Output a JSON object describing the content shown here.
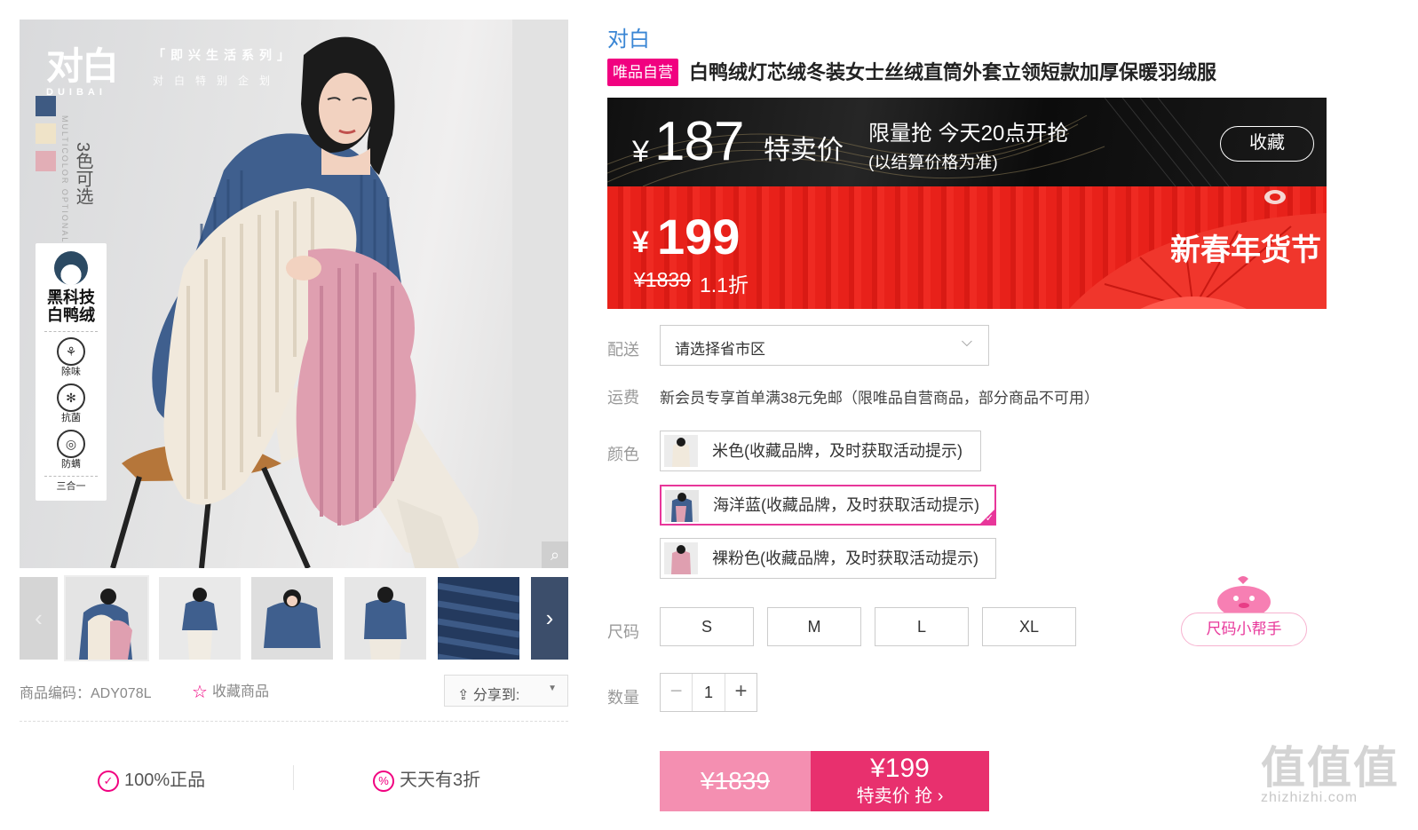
{
  "gallery": {
    "brand_logo_text": "对白",
    "brand_logo_sub": "DUIBAI",
    "series_title": "「即兴生活系列」",
    "series_sub": "对白特别企划",
    "multicolor_text": "MULTICOLOR OPTIONAL",
    "colors_available": "3色可选",
    "swatch_colors": [
      "#3e5a82",
      "#efe3c8",
      "#e2aeb6"
    ],
    "tech_title": "黑科技白鸭绒",
    "tech_features": [
      {
        "label": "除味",
        "icon": "deodorize-icon"
      },
      {
        "label": "抗菌",
        "icon": "antibacterial-icon"
      },
      {
        "label": "防螨",
        "icon": "anti-mite-icon"
      }
    ],
    "tech_footer": "三合一",
    "zoom_icon": "magnifier-icon"
  },
  "meta": {
    "sku": "商品编码：ADY078L",
    "favorite": "收藏商品",
    "share": "分享到:"
  },
  "assurances": [
    "100%正品",
    "天天有3折"
  ],
  "product": {
    "brand": "对白",
    "self_badge": "唯品自营",
    "title": "白鸭绒灯芯绒冬装女士丝绒直筒外套立领短款加厚保暖羽绒服"
  },
  "flash_sale": {
    "currency": "¥",
    "price": "187",
    "price_tag": "特卖价",
    "notice": "限量抢 今天20点开抢",
    "sub": "(以结算价格为准)",
    "collect": "收藏"
  },
  "current_sale": {
    "currency": "¥",
    "price": "199",
    "original": "¥1839",
    "discount": "1.1折",
    "slogan": "新春年货节"
  },
  "delivery": {
    "label": "配送",
    "placeholder": "请选择省市区"
  },
  "shipping": {
    "label": "运费",
    "text": "新会员专享首单满38元免邮（限唯品自营商品，部分商品不可用）"
  },
  "color": {
    "label": "颜色",
    "options": [
      {
        "name": "米色(收藏品牌，及时获取活动提示)",
        "selected": false
      },
      {
        "name": "海洋蓝(收藏品牌，及时获取活动提示)",
        "selected": true
      },
      {
        "name": "裸粉色(收藏品牌，及时获取活动提示)",
        "selected": false
      }
    ]
  },
  "size": {
    "label": "尺码",
    "options": [
      "S",
      "M",
      "L",
      "XL"
    ],
    "helper": "尺码小帮手"
  },
  "quantity": {
    "label": "数量",
    "value": "1",
    "minus": "−",
    "plus": "+"
  },
  "buy": {
    "original": "¥1839",
    "price": "¥199",
    "action": "特卖价 抢 ›"
  },
  "watermark": {
    "logo": "值值值",
    "url": "zhizhizhi.com"
  }
}
